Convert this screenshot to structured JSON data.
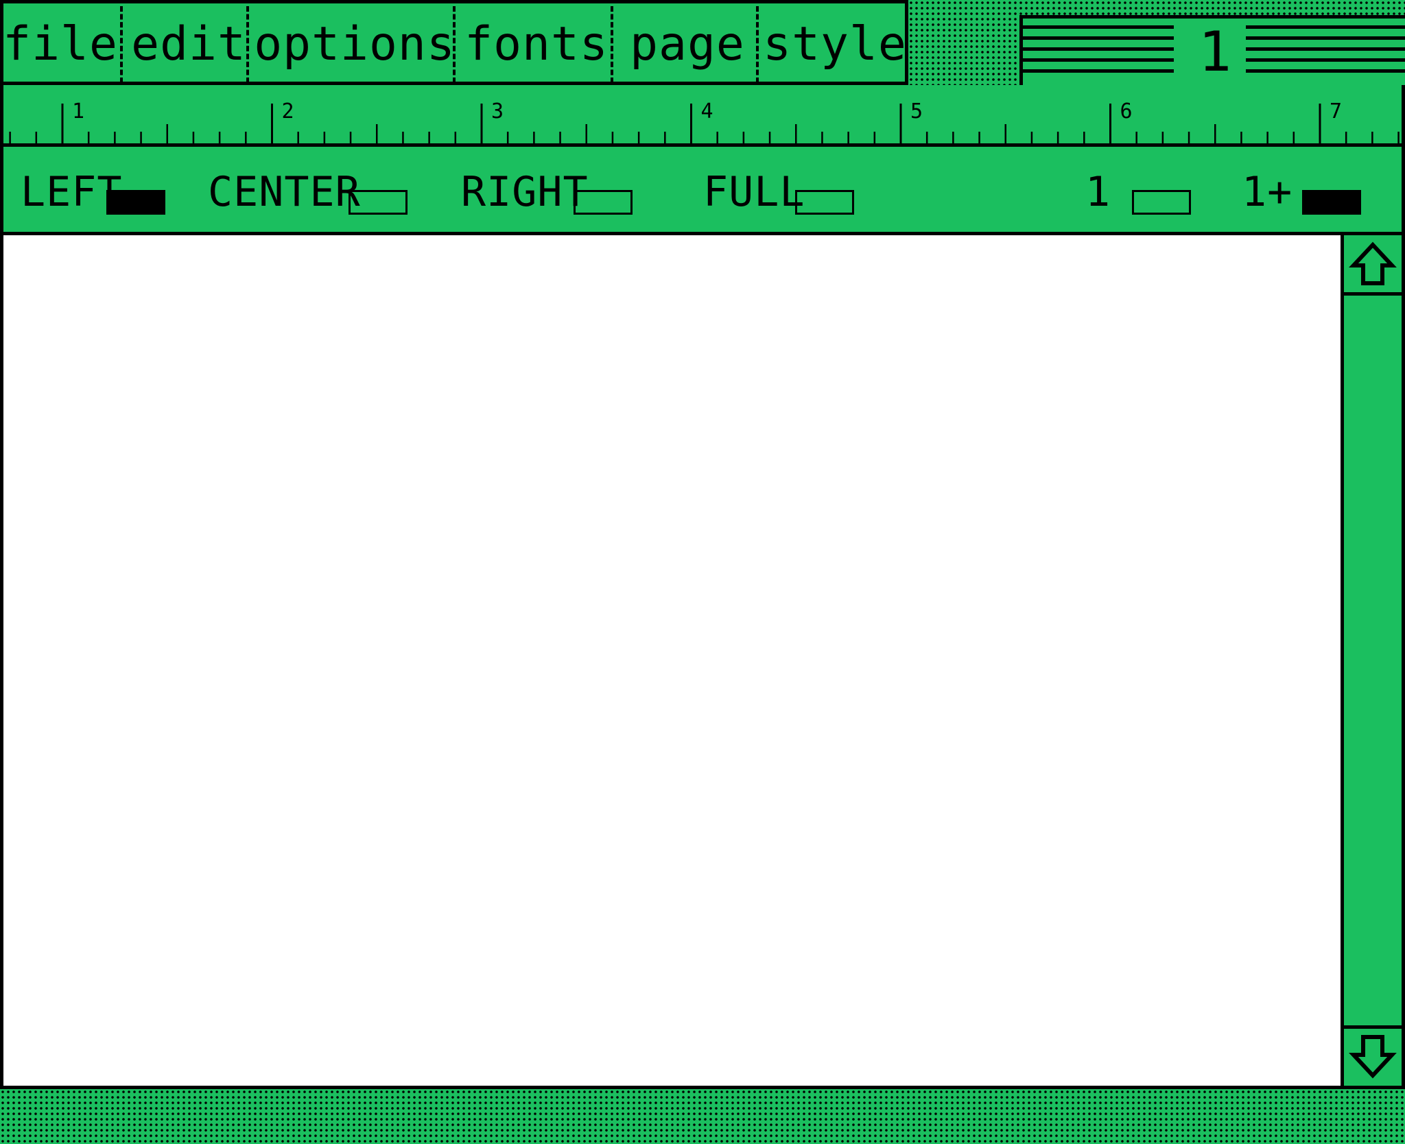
{
  "menu": {
    "items": [
      {
        "label": "file"
      },
      {
        "label": "edit"
      },
      {
        "label": "options"
      },
      {
        "label": "fonts"
      },
      {
        "label": "page"
      },
      {
        "label": "style"
      }
    ]
  },
  "page_indicator": {
    "page_number": "1"
  },
  "ruler": {
    "labels": [
      "1",
      "2",
      "3",
      "4",
      "5",
      "6",
      "7"
    ]
  },
  "alignment": {
    "left": {
      "label": "LEFT",
      "selected": true
    },
    "center": {
      "label": "CENTER",
      "selected": false
    },
    "right": {
      "label": "RIGHT",
      "selected": false
    },
    "full": {
      "label": "FULL",
      "selected": false
    }
  },
  "spacing": {
    "single": {
      "label": "1",
      "selected": false
    },
    "one_plus": {
      "label": "1+",
      "selected": true
    }
  },
  "colors": {
    "background": "#1bbf5f",
    "ink": "#000000",
    "paper": "#ffffff"
  }
}
